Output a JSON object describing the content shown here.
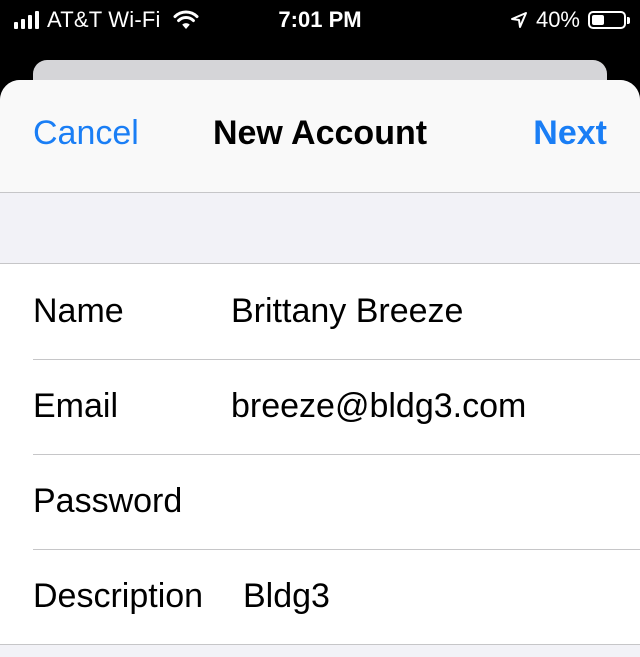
{
  "status_bar": {
    "carrier": "AT&T Wi-Fi",
    "time": "7:01 PM",
    "battery_percent": "40%",
    "battery_level": 0.4,
    "signal_icon": "signal-bars-icon",
    "wifi_icon": "wifi-icon",
    "location_icon": "location-arrow-icon"
  },
  "navbar": {
    "cancel_label": "Cancel",
    "title": "New Account",
    "next_label": "Next",
    "accent_color": "#1a7ef5"
  },
  "form": {
    "name_label": "Name",
    "name_value": "Brittany Breeze",
    "email_label": "Email",
    "email_value": "breeze@bldg3.com",
    "password_label": "Password",
    "password_value": "",
    "description_label": "Description",
    "description_value": "Bldg3"
  }
}
